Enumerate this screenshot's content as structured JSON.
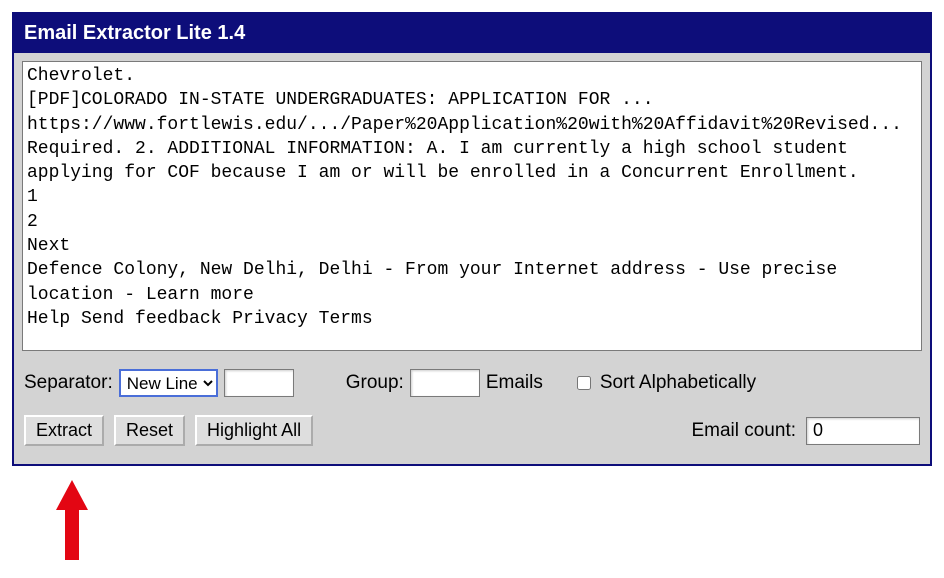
{
  "header": {
    "title": "Email Extractor Lite 1.4"
  },
  "input": {
    "text": "Chevrolet.\n[PDF]COLORADO IN-STATE UNDERGRADUATES: APPLICATION FOR ...\nhttps://www.fortlewis.edu/.../Paper%20Application%20with%20Affidavit%20Revised...\nRequired. 2. ADDITIONAL INFORMATION: A. I am currently a high school student applying for COF because I am or will be enrolled in a Concurrent Enrollment.\n1\n2\nNext\nDefence Colony, New Delhi, Delhi - From your Internet address - Use precise location - Learn more\nHelp Send feedback Privacy Terms"
  },
  "controls": {
    "separator_label": "Separator:",
    "separator_selected": "New Line",
    "separator_custom": "",
    "group_label": "Group:",
    "group_value": "",
    "group_unit": "Emails",
    "sort_label": "Sort Alphabetically",
    "sort_checked": false
  },
  "buttons": {
    "extract": "Extract",
    "reset": "Reset",
    "highlight": "Highlight All"
  },
  "output": {
    "count_label": "Email count:",
    "count_value": "0"
  },
  "annotation": {
    "arrow_color": "#e30613"
  }
}
